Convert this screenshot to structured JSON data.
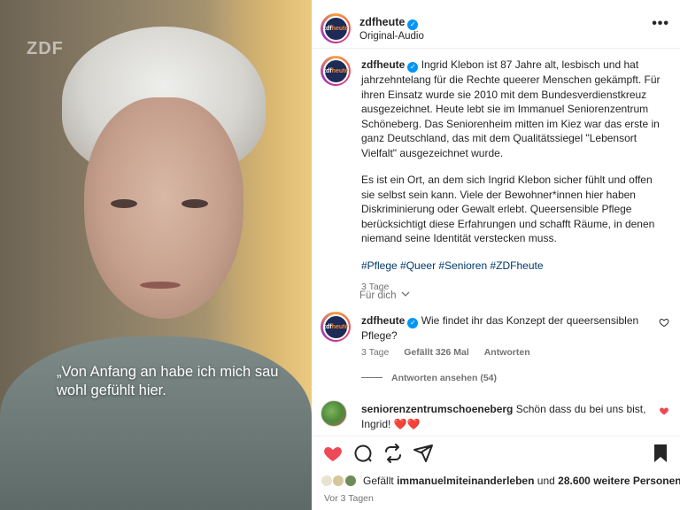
{
  "media": {
    "logo_text": "ZDF",
    "caption": "„Von Anfang an habe ich mich sau wohl gefühlt hier."
  },
  "header": {
    "account": "zdfheute",
    "audio": "Original-Audio",
    "more": "•••",
    "avatar_text_1": "zdf",
    "avatar_text_2": "heute"
  },
  "post": {
    "account": "zdfheute",
    "paragraph_1": "Ingrid Klebon ist 87 Jahre alt, lesbisch und hat jahrzehntelang für die Rechte queerer Menschen gekämpft. Für ihren Einsatz wurde sie 2010 mit dem Bundesverdienstkreuz ausgezeichnet. Heute lebt sie im Immanuel Seniorenzentrum Schöneberg. Das Seniorenheim mitten im Kiez war das erste in ganz Deutschland, das mit dem Qualitätssiegel \"Lebensort Vielfalt\" ausgezeichnet wurde.",
    "paragraph_2": "Es ist ein Ort, an dem sich Ingrid Klebon sicher fühlt und offen sie selbst sein kann. Viele der Bewohner*innen hier haben Diskriminierung oder Gewalt erlebt. Queersensible Pflege berücksichtigt diese Erfahrungen und schafft Räume, in denen niemand seine Identität verstecken muss.",
    "hashtags": [
      "#Pflege",
      "#Queer",
      "#Senioren",
      "#ZDFheute"
    ],
    "age": "3 Tage"
  },
  "for_whom": "Für dich",
  "comments": [
    {
      "account": "zdfheute",
      "text": "Wie findet ihr das Konzept der queersensiblen Pflege?",
      "age": "3 Tage",
      "likes": "Gefällt 326 Mal",
      "reply": "Antworten",
      "liked": false
    },
    {
      "account": "seniorenzentrumschoeneberg",
      "text": "Schön dass du bei uns bist, Ingrid! ❤️❤️",
      "liked": true
    }
  ],
  "view_replies": "Antworten ansehen (54)",
  "likes_line": {
    "prefix": "Gefällt",
    "user": "immanuelmiteinanderleben",
    "middle": "und",
    "count": "28.600 weitere Personen"
  },
  "date": "Vor 3 Tagen",
  "colors": {
    "like_red": "#ed4956",
    "link_blue": "#00376b",
    "verified_blue": "#0095f6"
  }
}
